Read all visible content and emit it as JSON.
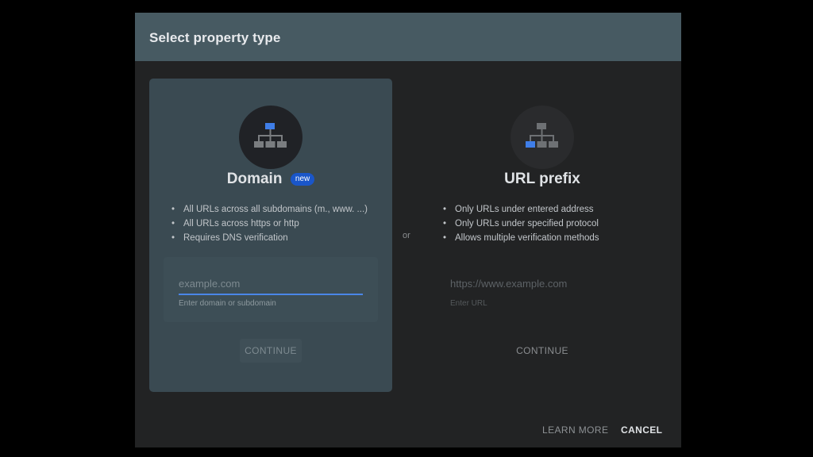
{
  "dialog": {
    "title": "Select property type",
    "separator": "or",
    "footer": {
      "learn_more": "LEARN MORE",
      "cancel": "CANCEL"
    }
  },
  "domain_card": {
    "icon": "sitemap-icon",
    "title": "Domain",
    "badge": "new",
    "features": [
      "All URLs across all subdomains (m., www. ...)",
      "All URLs across https or http",
      "Requires DNS verification"
    ],
    "input_value": "",
    "input_placeholder": "example.com",
    "input_hint": "Enter domain or subdomain",
    "continue": "CONTINUE"
  },
  "url_card": {
    "icon": "sitemap-icon",
    "title": "URL prefix",
    "features": [
      "Only URLs under entered address",
      "Only URLs under specified protocol",
      "Allows multiple verification methods"
    ],
    "input_value": "",
    "input_placeholder": "https://www.example.com",
    "input_hint": "Enter URL",
    "continue": "CONTINUE"
  },
  "colors": {
    "header_bg": "#475a62",
    "dialog_bg": "#222324",
    "selected_card_bg": "#3a4a52",
    "accent_blue": "#4a86e8",
    "badge_blue": "#1a56c9"
  }
}
